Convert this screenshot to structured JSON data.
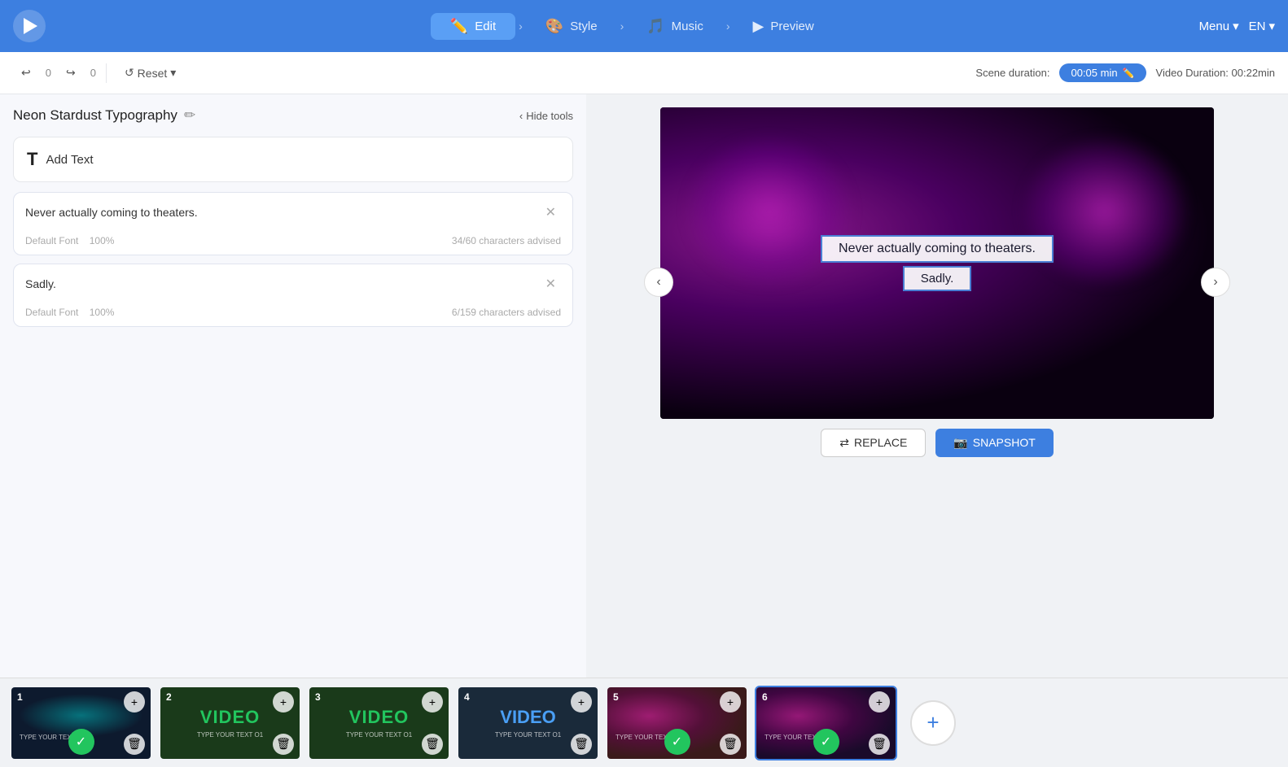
{
  "app": {
    "logo_alt": "Viddyoze"
  },
  "nav": {
    "steps": [
      {
        "id": "edit",
        "label": "Edit",
        "icon": "✏️",
        "active": true
      },
      {
        "id": "style",
        "label": "Style",
        "icon": "🎨",
        "active": false
      },
      {
        "id": "music",
        "label": "Music",
        "icon": "🎵",
        "active": false
      },
      {
        "id": "preview",
        "label": "Preview",
        "icon": "▶",
        "active": false
      }
    ],
    "menu_label": "Menu",
    "lang_label": "EN"
  },
  "toolbar": {
    "undo_count": "0",
    "redo_count": "0",
    "reset_label": "Reset",
    "scene_duration_label": "Scene duration:",
    "scene_duration_value": "00:05 min",
    "video_duration_label": "Video Duration: 00:22min"
  },
  "panel": {
    "title": "Neon Stardust Typography",
    "hide_tools_label": "Hide tools",
    "add_text_label": "Add Text",
    "text_entries": [
      {
        "id": "text1",
        "content": "Never actually coming to theaters.",
        "font": "Default Font",
        "scale": "100%",
        "char_count": "34/60 characters advised"
      },
      {
        "id": "text2",
        "content": "Sadly.",
        "font": "Default Font",
        "scale": "100%",
        "char_count": "6/159 characters advised"
      }
    ]
  },
  "preview": {
    "text_line1": "Never actually coming to theaters.",
    "text_line2": "Sadly.",
    "replace_label": "REPLACE",
    "snapshot_label": "SNAPSHOT"
  },
  "filmstrip": {
    "slides": [
      {
        "number": "1",
        "type": "teal",
        "has_check": true,
        "active": false
      },
      {
        "number": "2",
        "type": "green-text",
        "label": "VIDEO",
        "has_check": false,
        "active": false
      },
      {
        "number": "3",
        "type": "green-text",
        "label": "VIDEO",
        "has_check": false,
        "active": false
      },
      {
        "number": "4",
        "type": "blue-text",
        "label": "VIDEO",
        "has_check": false,
        "active": false
      },
      {
        "number": "5",
        "type": "magenta",
        "has_check": true,
        "active": false
      },
      {
        "number": "6",
        "type": "magenta",
        "has_check": true,
        "active": true
      }
    ],
    "add_label": "+"
  }
}
